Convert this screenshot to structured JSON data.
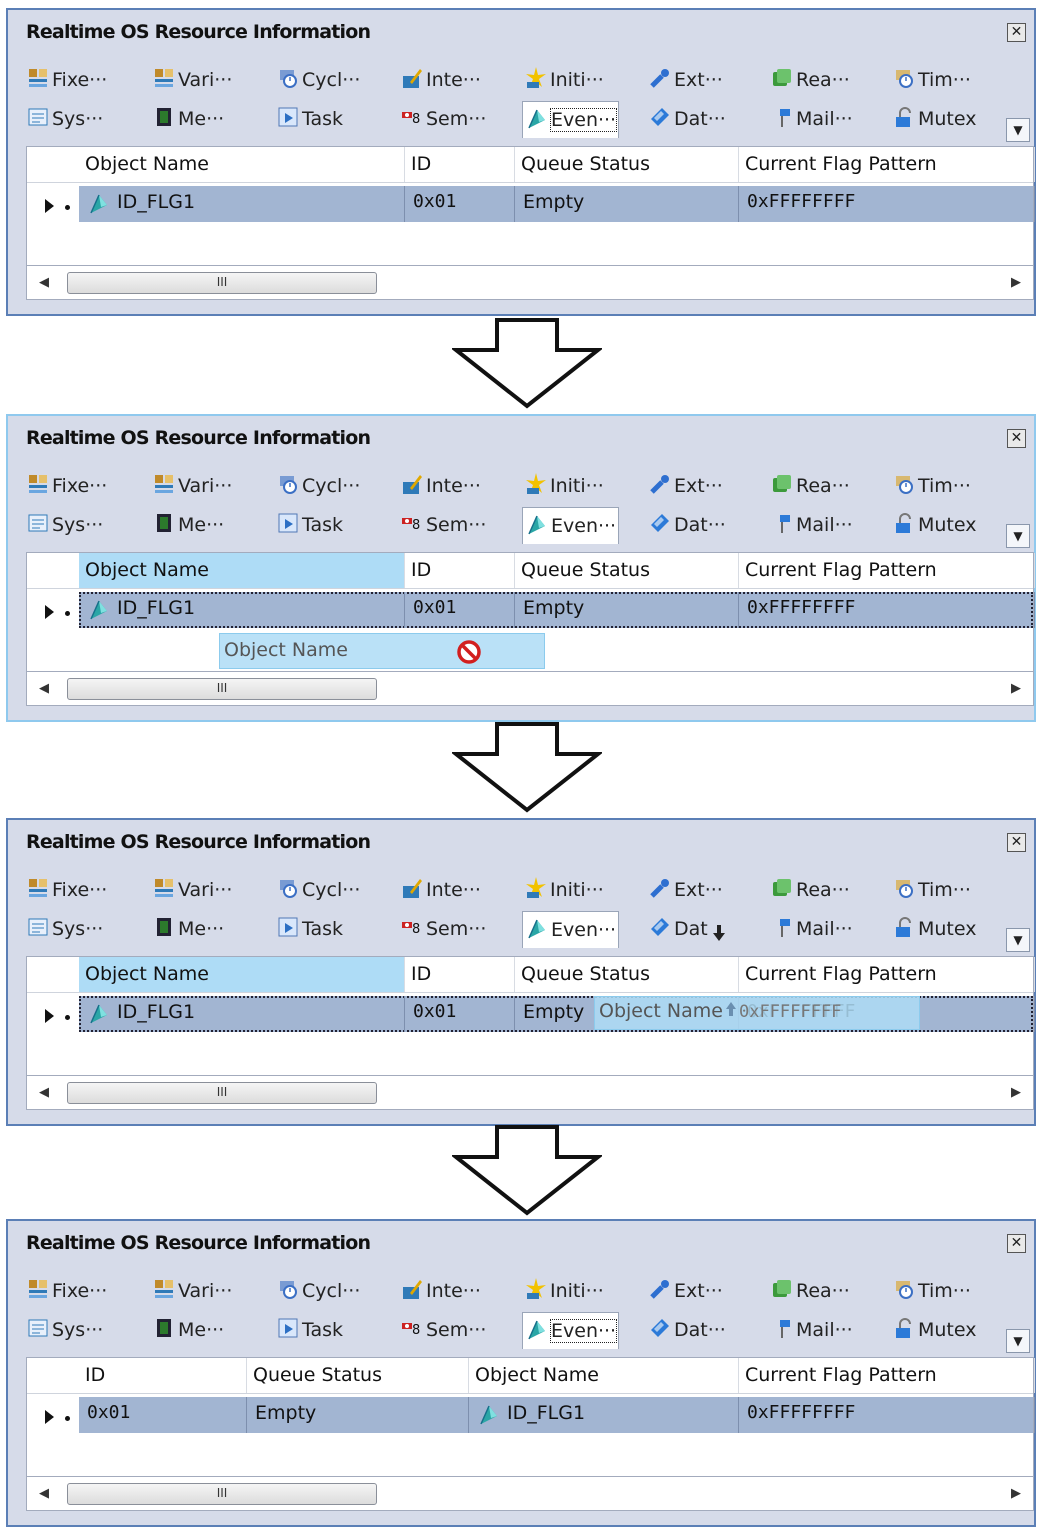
{
  "window": {
    "title": "Realtime OS Resource Information",
    "close_icon": "close-icon",
    "overflow_icon": "chevron-down-icon"
  },
  "tabs_row1": [
    {
      "label": "Fixe···",
      "icon": "fixed-memory-icon",
      "color": "#c08a2a"
    },
    {
      "label": "Vari···",
      "icon": "variable-memory-icon",
      "color": "#c08a2a"
    },
    {
      "label": "Cycl···",
      "icon": "cyclic-handler-icon",
      "color": "#3b6fc4"
    },
    {
      "label": "Inte···",
      "icon": "interrupt-icon",
      "color": "#e0a800"
    },
    {
      "label": "Initi···",
      "icon": "init-routine-icon",
      "color": "#f2c200"
    },
    {
      "label": "Ext···",
      "icon": "extended-icon",
      "color": "#2e6fd0"
    },
    {
      "label": "Rea···",
      "icon": "ready-queue-icon",
      "color": "#3c9a3c"
    },
    {
      "label": "Tim···",
      "icon": "timer-icon",
      "color": "#d8a020"
    }
  ],
  "tabs_row2": [
    {
      "label": "Sys···",
      "icon": "system-icon",
      "color": "#2f7ab8"
    },
    {
      "label": "Me···",
      "icon": "memory-icon",
      "color": "#2c7a2c"
    },
    {
      "label": "Task",
      "icon": "task-icon",
      "color": "#2c6fc4"
    },
    {
      "label": "Sem···",
      "icon": "semaphore-icon",
      "color": "#cc2222"
    },
    {
      "label": "Even···",
      "icon": "eventflag-icon",
      "color": "#2aa6a6"
    },
    {
      "label": "Dat···",
      "icon": "dataqueue-icon",
      "color": "#2c7ad8"
    },
    {
      "label": "Mail···",
      "icon": "mailbox-icon",
      "color": "#2c7ad8"
    },
    {
      "label": "Mutex",
      "icon": "mutex-icon",
      "color": "#2c7ad8"
    }
  ],
  "tabs_row2_step3": {
    "label_dat": "Dat"
  },
  "columns": {
    "object_name": "Object Name",
    "id": "ID",
    "queue_status": "Queue Status",
    "current_flag_pattern": "Current Flag Pattern"
  },
  "row": {
    "object_name": "ID_FLG1",
    "id": "0x01",
    "queue_status": "Empty",
    "current_flag_pattern": "0xFFFFFFFF"
  },
  "scrollbar": {
    "thumb_grip": "III",
    "left_arrow": "◀",
    "right_arrow": "▶"
  },
  "drag": {
    "label": "Object Name",
    "ghost_value": "0xFFFFFFFF",
    "no_drop_icon": "no-drop-icon",
    "drop_marker_icon": "drop-position-arrow-icon"
  },
  "colors": {
    "row_selected": "#a2b5d2",
    "header_highlight": "#aedcf6",
    "window_border": "#5b7fb6"
  }
}
